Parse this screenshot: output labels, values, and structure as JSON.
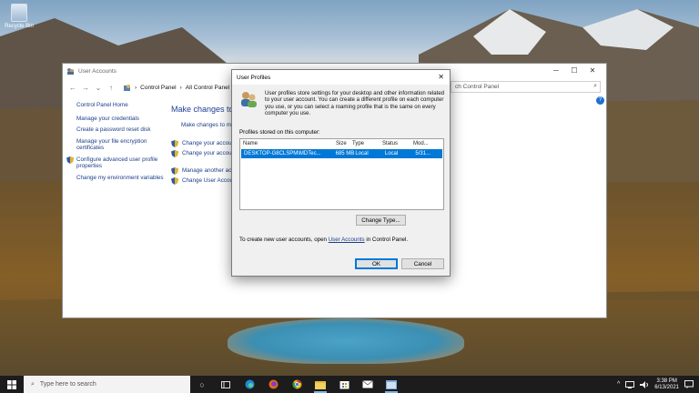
{
  "desktop": {
    "recycle_bin_label": "Recycle Bin"
  },
  "control_panel": {
    "window_title": "User Accounts",
    "window_controls": {
      "minimize": "─",
      "maximize": "☐",
      "close": "✕"
    },
    "nav": {
      "back": "←",
      "forward": "→",
      "dropdown": "⌄",
      "up": "↑"
    },
    "breadcrumbs": [
      "Control Panel",
      "All Control Panel Ite"
    ],
    "breadcrumb_sep": "›",
    "search_placeholder": "ch Control Panel",
    "help": "?",
    "sidebar": {
      "home": "Control Panel Home",
      "items": [
        "Manage your credentials",
        "Create a password reset disk",
        "Manage your file encryption certificates",
        "Configure advanced user profile properties",
        "Change my environment variables"
      ]
    },
    "heading": "Make changes to",
    "subheading": "Make changes to m",
    "links": [
      "Change your accou",
      "Change your accou",
      "Manage another ac",
      "Change User Accou"
    ]
  },
  "dialog": {
    "title": "User Profiles",
    "close": "✕",
    "intro": "User profiles store settings for your desktop and other information related to your user account. You can create a different profile on each computer you use, or you can select a roaming profile that is the same on every computer you use.",
    "stored_label": "Profiles stored on this computer:",
    "columns": [
      "Name",
      "Size",
      "Type",
      "Status",
      "Mod..."
    ],
    "rows": [
      {
        "name": "DESKTOP-G8CLSPM\\MDTec...",
        "size": "685 MB",
        "type": "Local",
        "status": "Local",
        "modified": "5/31..."
      }
    ],
    "change_type_button": "Change Type...",
    "create_prefix": "To create new user accounts, open",
    "create_link": "User Accounts",
    "create_suffix": "in Control Panel.",
    "ok_button": "OK",
    "cancel_button": "Cancel"
  },
  "taskbar": {
    "search_placeholder": "Type here to search",
    "time": "3:38 PM",
    "date": "6/13/2021",
    "tray_chevron": "^",
    "task_view_glyph": "○",
    "apps": [
      "edge-icon",
      "firefox-icon",
      "chrome-icon",
      "file-explorer-icon",
      "store-icon",
      "mail-icon",
      "user-accounts-icon"
    ]
  },
  "colors": {
    "accent": "#0078d7",
    "link": "#1a3e8a",
    "taskbar": "#1c1c1c"
  }
}
